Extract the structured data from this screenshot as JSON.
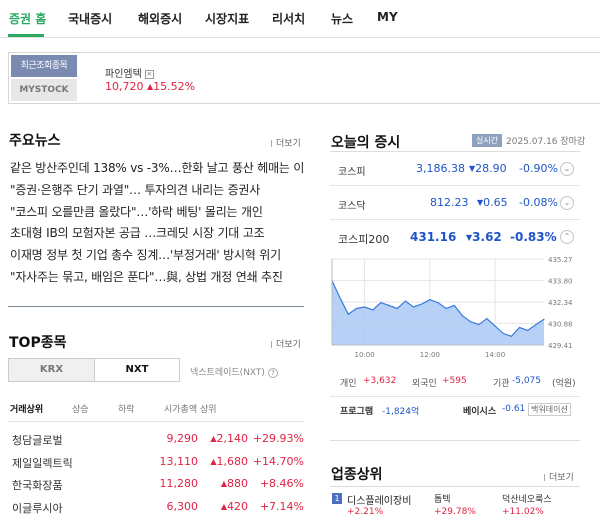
{
  "nav": {
    "tabs": [
      "증권 홈",
      "국내증시",
      "해외증시",
      "시장지표",
      "리서치",
      "뉴스",
      "MY"
    ]
  },
  "recent": {
    "label": "최근조회종목",
    "my_label": "MYSTOCK",
    "stock_name": "파인엠텍",
    "remove_icon": "×",
    "price": "10,720",
    "change": "15.52%"
  },
  "news": {
    "title": "주요뉴스",
    "more": "더보기",
    "items": [
      "같은 방산주인데 138% vs -3%…한화 날고 풍산 헤매는 이유",
      "\"증권·은행주 단기 과열\"… 투자의견 내리는 증권사",
      "\"코스피 오를만큼 올랐다\"…'하락 베팅' 몰리는 개인",
      "초대형 IB의 모험자본 공급 …크레딧 시장 기대 고조",
      "이재명 정부 첫 기업 총수 징계…'부정거래' 방시혁 위기",
      "\"자사주는 묶고, 배임은 푼다\"…與, 상법 개정 연쇄 추진"
    ]
  },
  "top": {
    "title": "TOP종목",
    "more": "더보기",
    "krx": "KRX",
    "nxt": "NXT",
    "nxt_label": "넥스트레이드(NXT)",
    "info_icon": "?",
    "tabs": [
      "거래상위",
      "상승",
      "하락",
      "시가총액 상위"
    ],
    "rows": [
      {
        "name": "청담글로벌",
        "price": "9,290",
        "change": "2,140",
        "pct": "+29.93%"
      },
      {
        "name": "제일일렉트릭",
        "price": "13,110",
        "change": "1,680",
        "pct": "+14.70%"
      },
      {
        "name": "한국화장품",
        "price": "11,280",
        "change": "880",
        "pct": "+8.46%"
      },
      {
        "name": "이글루시아",
        "price": "6,300",
        "change": "420",
        "pct": "+7.14%"
      }
    ]
  },
  "market": {
    "title": "오늘의 증시",
    "badge": "실시간",
    "date": "2025.07.16 장마감",
    "indices": [
      {
        "name": "코스피",
        "value": "3,186.38",
        "change": "28.90",
        "pct": "-0.90%"
      },
      {
        "name": "코스닥",
        "value": "812.23",
        "change": "0.65",
        "pct": "-0.08%"
      },
      {
        "name": "코스피200",
        "value": "431.16",
        "change": "3.62",
        "pct": "-0.83%"
      }
    ],
    "flows": {
      "individual_label": "개인",
      "individual": "+3,632",
      "foreign_label": "외국인",
      "foreign": "+595",
      "inst_label": "기관",
      "inst": "-5,075",
      "unit": "(억원)"
    },
    "program": {
      "label": "프로그램",
      "value": "-1,824억",
      "basis_label": "베이시스",
      "basis": "-0.61",
      "basis_tag": "백워데이션"
    }
  },
  "sector": {
    "title": "업종상위",
    "more": "더보기",
    "rank": "1",
    "name": "디스플레이장비",
    "pct": "+2.21%",
    "stock1": "톱텍",
    "stock1_pct": "+29.78%",
    "stock2": "덕산네오룩스",
    "stock2_pct": "+11.02%"
  },
  "chart_data": {
    "type": "area",
    "ylim": [
      429.41,
      435.27
    ],
    "yticks": [
      "435.27",
      "433.80",
      "432.34",
      "430.88",
      "429.41"
    ],
    "xticks": [
      "10:00",
      "12:00",
      "14:00"
    ],
    "x": [
      "09:00",
      "09:15",
      "09:30",
      "09:45",
      "10:00",
      "10:15",
      "10:30",
      "10:45",
      "11:00",
      "11:15",
      "11:30",
      "11:45",
      "12:00",
      "12:15",
      "12:30",
      "12:45",
      "13:00",
      "13:15",
      "13:30",
      "13:45",
      "14:00",
      "14:15",
      "14:30",
      "14:45",
      "15:00",
      "15:15",
      "15:30"
    ],
    "values": [
      433.8,
      432.6,
      431.5,
      431.9,
      432.0,
      431.8,
      432.3,
      432.1,
      431.9,
      432.4,
      432.0,
      432.2,
      432.5,
      432.3,
      431.9,
      432.1,
      431.4,
      431.0,
      430.8,
      431.2,
      430.7,
      430.2,
      430.0,
      430.6,
      430.4,
      430.8,
      431.16
    ],
    "colors": {
      "line": "#3a7be0",
      "fill": "#a9c9f3",
      "grid": "#e5e5e5"
    }
  }
}
